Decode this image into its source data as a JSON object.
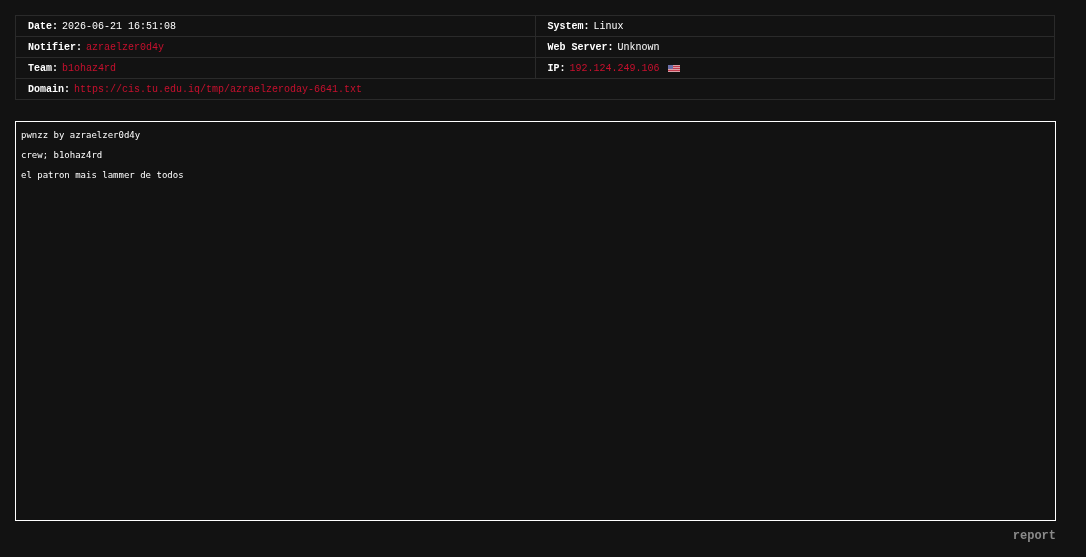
{
  "info_table": {
    "rows": [
      {
        "cells": [
          {
            "label": "Date:",
            "value": "2026-06-21 16:51:08",
            "highlight": false
          },
          {
            "label": "System:",
            "value": "Linux",
            "highlight": false
          }
        ]
      },
      {
        "cells": [
          {
            "label": "Notifier:",
            "value": "azraelzer0d4y",
            "highlight": true
          },
          {
            "label": "Web Server:",
            "value": "Unknown",
            "highlight": false
          }
        ]
      },
      {
        "cells": [
          {
            "label": "Team:",
            "value": "b1ohaz4rd",
            "highlight": true
          },
          {
            "label": "IP:",
            "value": "192.124.249.106",
            "highlight": true,
            "flag": true
          }
        ]
      },
      {
        "cells": [
          {
            "label": "Domain:",
            "value": "https://cis.tu.edu.iq/tmp/azraelzeroday-6641.txt",
            "highlight": true,
            "colspan": 2
          }
        ]
      }
    ]
  },
  "content": {
    "lines": [
      "pwnzz by azraelzer0d4y",
      "crew; b1ohaz4rd",
      "el patron mais lammer de todos"
    ]
  },
  "report_link": "report"
}
